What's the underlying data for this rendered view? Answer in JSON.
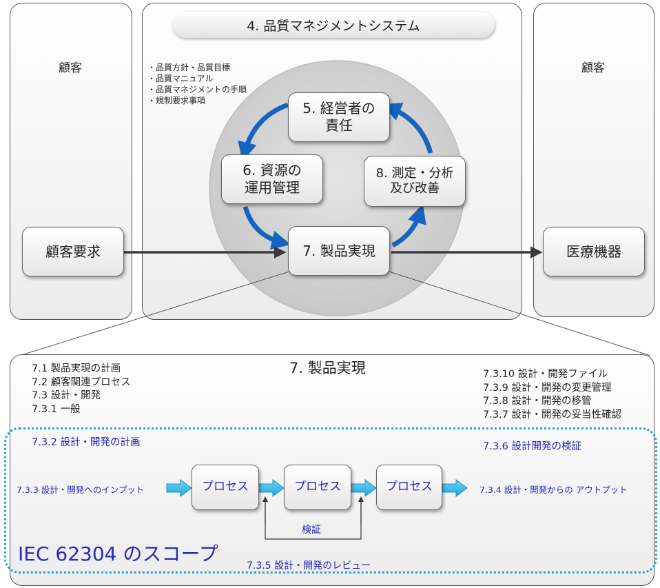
{
  "top": {
    "left_customer": "顧客",
    "right_customer": "顧客",
    "qms_title": "4. 品質マネジメントシステム",
    "qms_items": [
      "・品質方針・品質目標",
      "・品質マニュアル",
      "・品質マネジメントの手順",
      "・規制要求事項"
    ],
    "management": [
      "5. 経営者の",
      "責任"
    ],
    "resource": [
      "6. 資源の",
      "運用管理"
    ],
    "measure": [
      "8. 測定・分析",
      "及び改善"
    ],
    "realization": "7. 製品実現",
    "requirements": "顧客要求",
    "device": "医療機器"
  },
  "bottom": {
    "title": "7. 製品実現",
    "left_items": [
      "7.1 製品実現の計画",
      "7.2 顧客関連プロセス",
      "7.3 設計・開発",
      "7.3.1 一般"
    ],
    "right_items": [
      "7.3.10 設計・開発ファイル",
      "7.3.9 設計・開発の変更管理",
      "7.3.8 設計・開発の移管",
      "7.3.7 設計・開発の妥当性確認"
    ],
    "planning": "7.3.2 設計・開発の計画",
    "verification_title": "7.3.6 設計開発の検証",
    "input": "7.3.3 設計・開発へのインプット",
    "output": "7.3.4 設計・開発からの アウトプット",
    "process_labels": [
      "プロセス",
      "プロセス",
      "プロセス"
    ],
    "check": "検証",
    "scope": "IEC 62304 のスコープ",
    "review": "7.3.5 設計・開発のレビュー"
  }
}
